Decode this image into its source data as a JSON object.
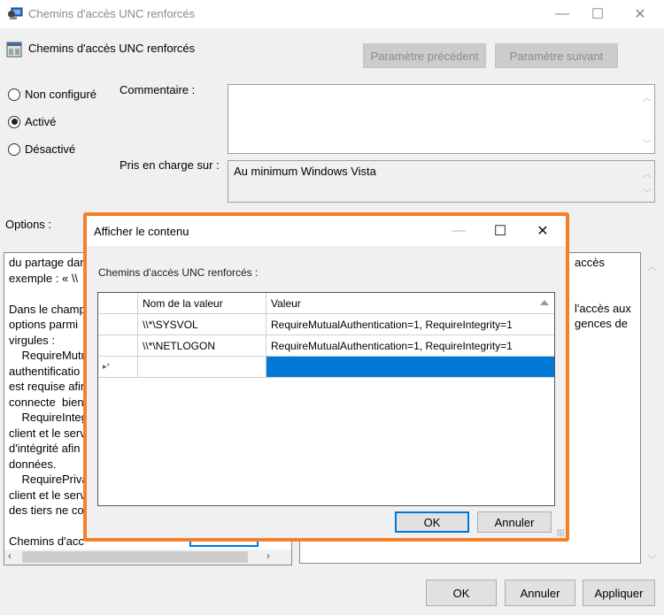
{
  "window": {
    "title": "Chemins d'accès UNC renforcés",
    "controls": {
      "minimize": "—",
      "maximize": "☐",
      "close": "✕"
    }
  },
  "policy": {
    "title": "Chemins d'accès UNC renforcés",
    "prev_button": "Paramètre précédent",
    "next_button": "Paramètre suivant"
  },
  "state": {
    "options": [
      {
        "label": "Non configuré",
        "selected": false
      },
      {
        "label": "Activé",
        "selected": true
      },
      {
        "label": "Désactivé",
        "selected": false
      }
    ]
  },
  "comment": {
    "label": "Commentaire :",
    "value": ""
  },
  "supported": {
    "label": "Pris en charge sur :",
    "value": "Au minimum Windows Vista"
  },
  "options_label": "Options :",
  "options_panel_lines": [
    "du partage dar",
    "exemple : « \\\\",
    "",
    "Dans le champ",
    "options parmi",
    "virgules :",
    "    RequireMutu",
    "authentificatio",
    "est requise afin",
    "connecte  bien",
    "    RequireInteg",
    "client et le serv",
    "d'intégrité afin",
    "données.",
    "    RequirePriva",
    "client et le serv",
    "des tiers ne co",
    "",
    "Chemins d'acc"
  ],
  "help_panel_fragments": [
    "accès",
    "l'accès aux",
    "gences de"
  ],
  "bottom_buttons": {
    "ok": "OK",
    "cancel": "Annuler",
    "apply": "Appliquer"
  },
  "dialog": {
    "title": "Afficher le contenu",
    "controls": {
      "minimize": "—",
      "maximize": "☐",
      "close": "✕"
    },
    "label": "Chemins d'accès UNC renforcés :",
    "columns": [
      "Nom de la valeur",
      "Valeur"
    ],
    "rows": [
      {
        "name": "\\\\*\\SYSVOL",
        "value": "RequireMutualAuthentication=1, RequireIntegrity=1"
      },
      {
        "name": "\\\\*\\NETLOGON",
        "value": "RequireMutualAuthentication=1, RequireIntegrity=1"
      }
    ],
    "new_row_glyph": "▸*",
    "ok": "OK",
    "cancel": "Annuler"
  },
  "colors": {
    "highlight_border": "#f57f2a",
    "selection": "#0078d7"
  }
}
